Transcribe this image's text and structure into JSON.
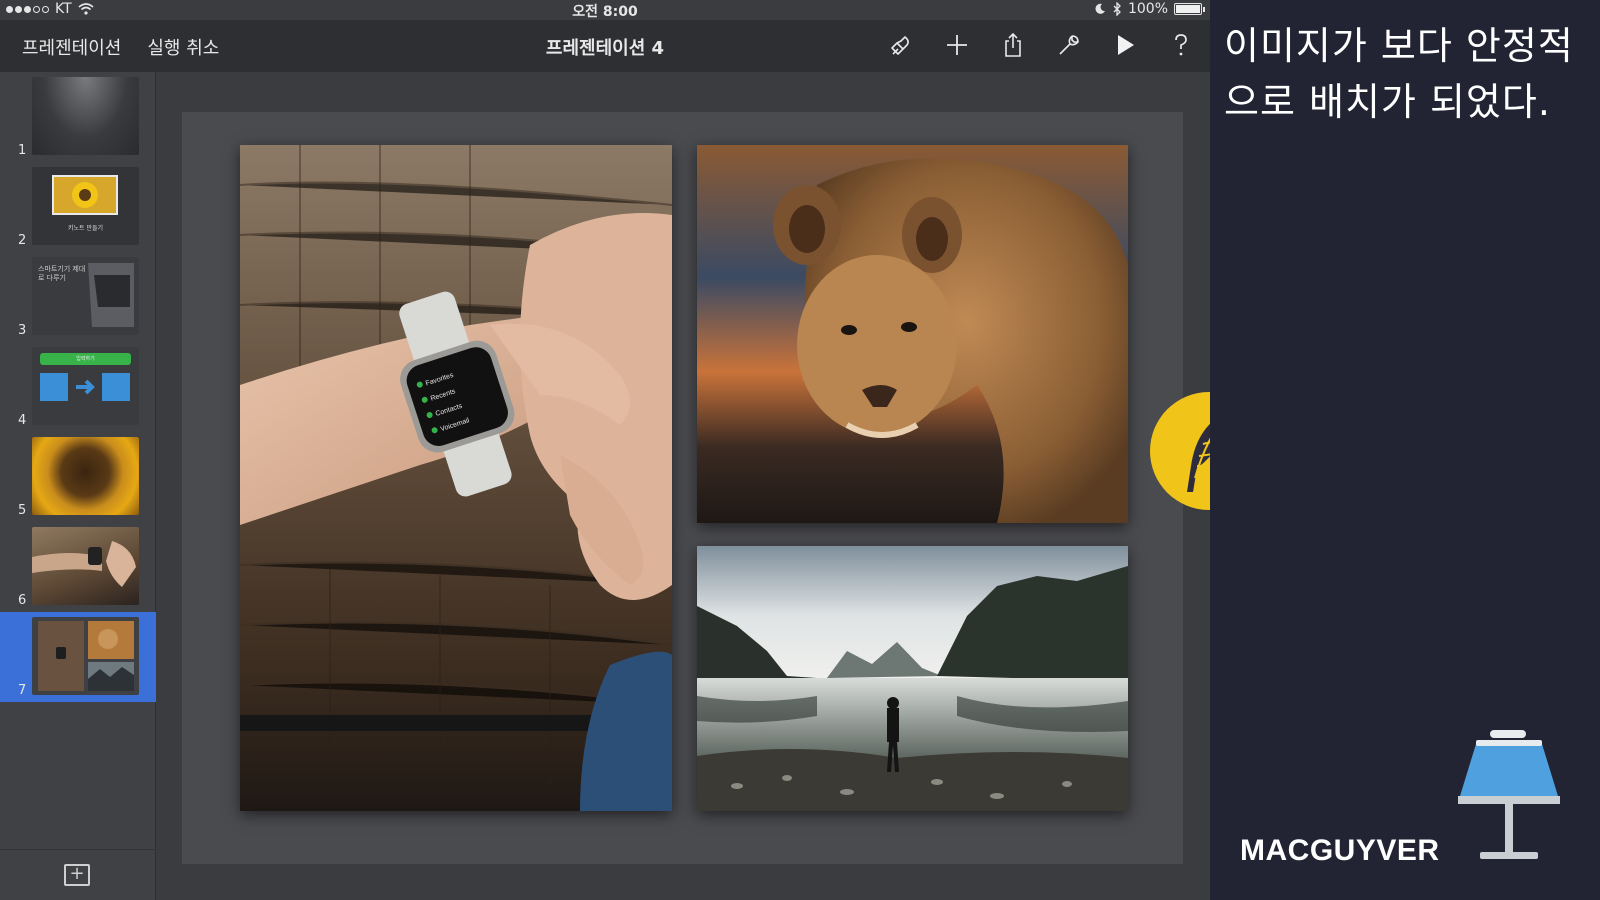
{
  "status_bar": {
    "carrier": "KT",
    "time": "오전 8:00",
    "battery_text": "100%",
    "battery_level": 1.0,
    "signal_bars_filled": 3,
    "signal_bars_total": 5
  },
  "toolbar": {
    "presentations_label": "프레젠테이션",
    "undo_label": "실행 취소",
    "document_title": "프레젠테이션 4",
    "icons": [
      "format-brush-icon",
      "add-icon",
      "share-icon",
      "tools-wrench-icon",
      "play-icon",
      "help-icon"
    ]
  },
  "navigator": {
    "slides": [
      {
        "number": "1",
        "kind": "blank-gradient"
      },
      {
        "number": "2",
        "kind": "sunflower-photo",
        "caption": "키노트 만들기"
      },
      {
        "number": "3",
        "kind": "text-and-laptop",
        "caption": "스마트기기 제대로 다루기"
      },
      {
        "number": "4",
        "kind": "diagram-green-blue",
        "caption": "입력하기"
      },
      {
        "number": "5",
        "kind": "sunflower-closeup"
      },
      {
        "number": "6",
        "kind": "watch-photo"
      },
      {
        "number": "7",
        "kind": "photo-collage",
        "selected": true
      }
    ],
    "add_slide_icon": "plus-square-icon"
  },
  "canvas": {
    "photos": [
      "apple-watch-on-wrist",
      "lioness",
      "mountain-lake-with-person"
    ],
    "watch_menu": [
      "Favorites",
      "Recents",
      "Contacts",
      "Voicemail"
    ]
  },
  "panel": {
    "caption_line1": "이미지가 보다 안정적",
    "caption_line2": "으로 배치가 되었다.",
    "brand": "MACGUYVER",
    "badge_icon": "feather-quill-icon",
    "logo_icon": "keynote-podium-icon"
  },
  "colors": {
    "selection_blue": "#3b70d8",
    "badge_yellow": "#f0c418",
    "panel_bg": "#222433",
    "keynote_blue": "#4ea0df"
  }
}
